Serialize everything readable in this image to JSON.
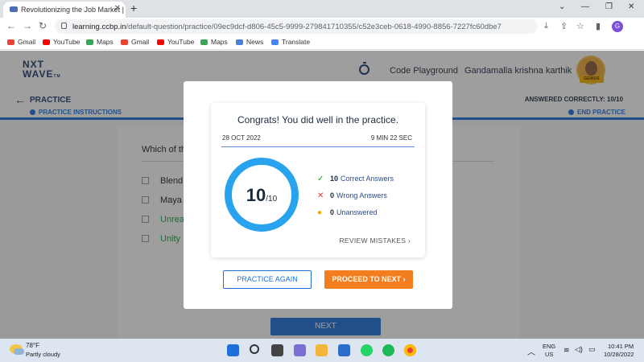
{
  "browser": {
    "tab_title": "Revolutionizing the Job Market |",
    "tab_close": "✕",
    "new_tab": "+",
    "url_host": "learning.ccbp.in",
    "url_path": "/default-question/practice/09ec9dcf-d806-45c5-9999-279841710355/c52e3ceb-0618-4990-8856-7227fc60dbe7",
    "profile_initial": "G",
    "bookmarks": [
      "Gmail",
      "YouTube",
      "Maps",
      "Gmail",
      "YouTube",
      "Maps",
      "News",
      "Translate"
    ]
  },
  "header": {
    "logo_line1": "NXT",
    "logo_line2": "WAVE",
    "logo_tm": "TM",
    "code_playground": "Code Playground",
    "user_name": "Gandamalla krishna karthik",
    "badge": "GENIUS"
  },
  "subheader": {
    "title": "PRACTICE",
    "instructions": "PRACTICE INSTRUCTIONS",
    "answered": "ANSWERED CORRECTLY: 10/10",
    "end_practice": "END PRACTICE"
  },
  "question": {
    "text": "Which of th",
    "options": [
      "Blend",
      "Maya",
      "Unrea",
      "Unity"
    ],
    "next_label": "NEXT"
  },
  "modal": {
    "congrats": "Congrats! You did well in the practice.",
    "date": "28 OCT 2022",
    "time": "9 MIN 22 SEC",
    "score": "10",
    "total": "/10",
    "correct_count": "10",
    "correct_label": "Correct Answers",
    "wrong_count": "0",
    "wrong_label": "Wrong Answers",
    "unanswered_count": "0",
    "unanswered_label": "Unanswered",
    "review_label": "REVIEW MISTAKES ›",
    "practice_again": "PRACTICE AGAIN",
    "proceed": "PROCEED TO NEXT ›"
  },
  "taskbar": {
    "temp": "78°F",
    "weather": "Partly cloudy",
    "lang1": "ENG",
    "lang2": "US",
    "time": "10:41 PM",
    "date": "10/28/2022"
  },
  "colors": {
    "accent": "#1e6fd9",
    "ring": "#29a3ee",
    "proceed": "#f27e20",
    "correct": "#1e9e3a",
    "wrong": "#e23b3b",
    "unanswered": "#f2a900"
  }
}
